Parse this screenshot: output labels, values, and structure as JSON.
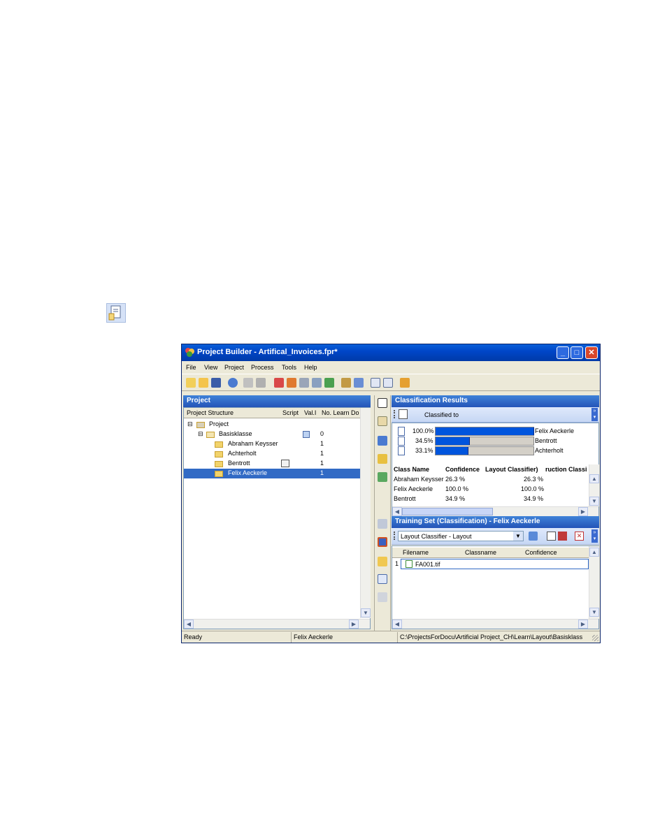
{
  "window": {
    "title": "Project Builder - Artifical_Invoices.fpr*"
  },
  "menu": [
    "File",
    "View",
    "Project",
    "Process",
    "Tools",
    "Help"
  ],
  "left_pane": {
    "title": "Project",
    "columns": [
      "Project Structure",
      "Script",
      "Val.I",
      "No. Learn Do"
    ],
    "tree": [
      {
        "label": "Project",
        "count": ""
      },
      {
        "label": "Basisklasse",
        "count": "0"
      },
      {
        "label": "Abraham Keysser",
        "count": "1"
      },
      {
        "label": "Achterholt",
        "count": "1"
      },
      {
        "label": "Bentrott",
        "count": "1"
      },
      {
        "label": "Felix Aeckerle",
        "count": "1"
      }
    ]
  },
  "classification": {
    "title": "Classification Results",
    "subtitle": "Classified to",
    "results": [
      {
        "percent": "100.0%",
        "value": 100.0,
        "name": "Felix Aeckerle"
      },
      {
        "percent": "34.5%",
        "value": 34.5,
        "name": "Bentrott"
      },
      {
        "percent": "33.1%",
        "value": 33.1,
        "name": "Achterholt"
      }
    ],
    "table_columns": [
      "Class Name",
      "Confidence",
      "Layout Classifier)",
      "ruction Classi"
    ],
    "table_rows": [
      {
        "name": "Abraham Keysser",
        "conf": "26.3 %",
        "layout": "26.3 %"
      },
      {
        "name": "Felix Aeckerle",
        "conf": "100.0 %",
        "layout": "100.0 %"
      },
      {
        "name": "Bentrott",
        "conf": "34.9 %",
        "layout": "34.9 %"
      }
    ]
  },
  "training": {
    "title": "Training Set (Classification) - Felix Aeckerle",
    "dropdown_value": "Layout Classifier - Layout",
    "columns": [
      "Filename",
      "Classname",
      "Confidence"
    ],
    "rows": [
      {
        "index": "1",
        "filename": "FA001.tif"
      }
    ]
  },
  "status_bar": {
    "state": "Ready",
    "class": "Felix Aeckerle",
    "path": "C:\\ProjectsForDocu\\Artificial Project_CH\\Learn\\Layout\\Basisklass"
  },
  "colors": {
    "titlebar": "#0046c8",
    "pane_header": "#2f66c8",
    "selection": "#316ac5",
    "bar_fill": "#0055dd"
  }
}
